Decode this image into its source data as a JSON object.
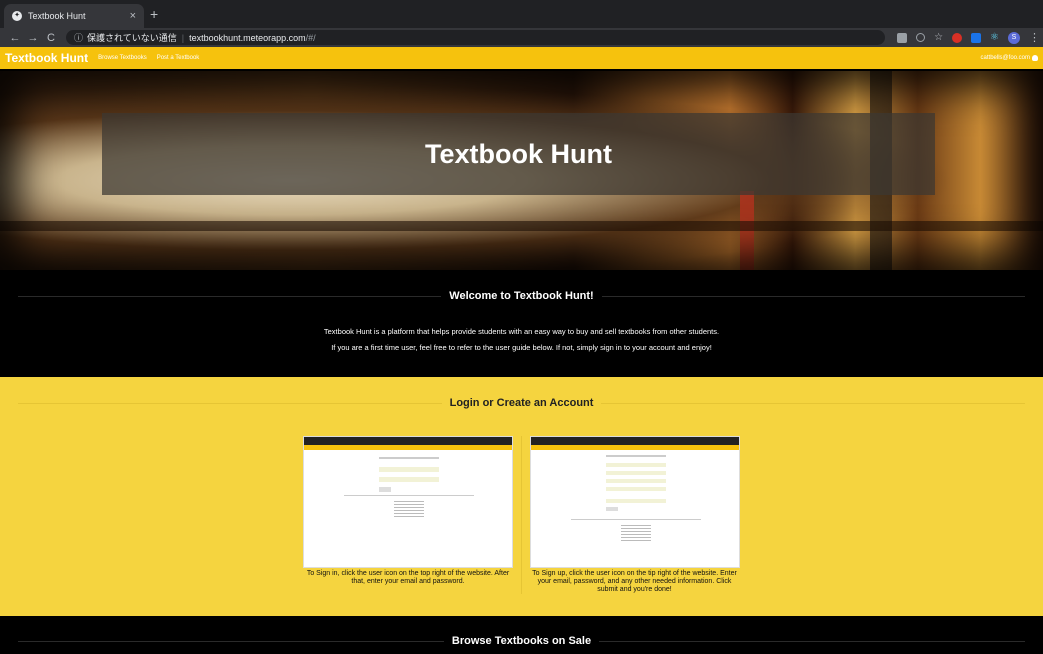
{
  "browser": {
    "tab_title": "Textbook Hunt",
    "tab_close": "×",
    "new_tab": "+",
    "back": "←",
    "forward": "→",
    "reload": "C",
    "info_icon": "ⓘ",
    "security_label": "保護されていない通信",
    "url_host": "textbookhunt.meteorapp.com",
    "url_path": "/#/",
    "profile_initial": "S",
    "menu": "⋮"
  },
  "site_nav": {
    "brand": "Textbook Hunt",
    "links": [
      "Browse Textbooks",
      "Post a Textbook"
    ],
    "user_email": "cattbells@foo.com"
  },
  "hero": {
    "title": "Textbook Hunt"
  },
  "welcome": {
    "title": "Welcome to Textbook Hunt!",
    "line1": "Textbook Hunt is a platform that helps provide students with an easy way to buy and sell textbooks from other students.",
    "line2": "If you are a first time user, feel free to refer to the user guide below. If not, simply sign in to your account and enjoy!"
  },
  "login": {
    "title": "Login or Create an Account",
    "signin_caption": "To Sign in, click the user icon on the top right of the website. After that, enter your email and password.",
    "signup_caption": "To Sign up, click the user icon on the tip right of the website. Enter your email, password, and any other needed information. Click submit and you're done!"
  },
  "browse": {
    "title": "Browse Textbooks on Sale"
  },
  "colors": {
    "nav_yellow": "#f6c20d",
    "section_yellow": "#f5d43f",
    "dark": "#000000"
  }
}
